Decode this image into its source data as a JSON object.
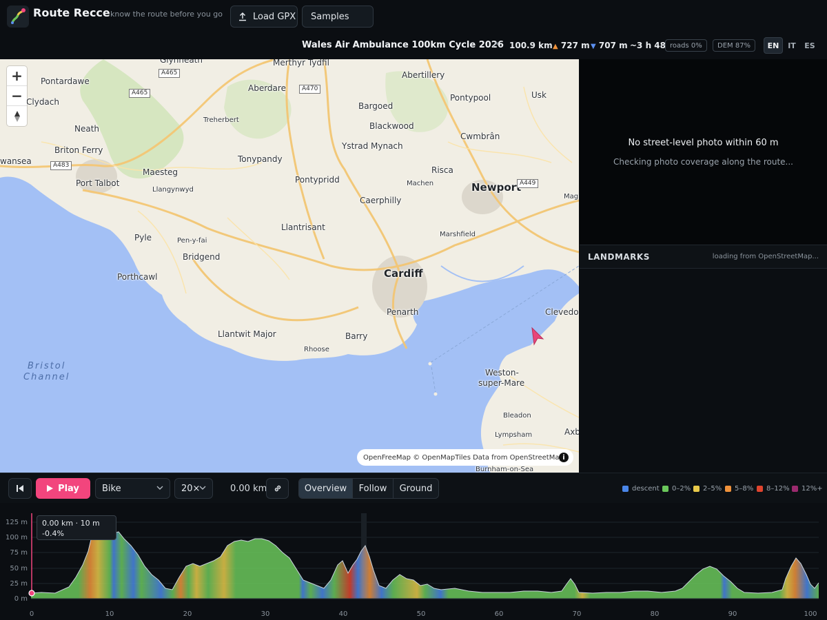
{
  "app": {
    "name": "Route Recce",
    "tagline": "know the route before you go"
  },
  "header": {
    "load_gpx_label": "Load GPX",
    "samples_label": "Samples"
  },
  "route": {
    "name": "Wales Air Ambulance 100km Cycle 2026",
    "distance": "100.9 km",
    "ascent": "727 m",
    "descent": "707 m",
    "duration": "~3 h 48",
    "roads_badge": "roads 0%",
    "dem_badge": "DEM 87%"
  },
  "languages": [
    {
      "code": "EN",
      "active": true
    },
    {
      "code": "IT",
      "active": false
    },
    {
      "code": "ES",
      "active": false
    }
  ],
  "map": {
    "towns": {
      "glynneath": "Glynneath",
      "merthyr": "Merthyr Tydfil",
      "abertillery": "Abertillery",
      "pontardawe": "Pontardawe",
      "aberdare": "Aberdare",
      "pontypool": "Pontypool",
      "usk": "Usk",
      "clydach": "Clydach",
      "bargoed": "Bargoed",
      "blackwood": "Blackwood",
      "cwmbran": "Cwmbrân",
      "neath": "Neath",
      "treherbert": "Treherbert",
      "britonferry": "Briton Ferry",
      "ystradmynach": "Ystrad Mynach",
      "swansea": "wansea",
      "tonypandy": "Tonypandy",
      "maesteg": "Maesteg",
      "risca": "Risca",
      "portalbot": "Port Talbot",
      "llangynwyd": "Llangynwyd",
      "pontypridd": "Pontypridd",
      "machen": "Machen",
      "newport": "Newport",
      "magor": "Mag",
      "caerphilly": "Caerphilly",
      "llantrisant": "Llantrisant",
      "marshfield": "Marshfield",
      "pyle": "Pyle",
      "penyfai": "Pen-y-fai",
      "bridgend": "Bridgend",
      "cardiff": "Cardiff",
      "porthcawl": "Porthcawl",
      "penarth": "Penarth",
      "clevedon": "Clevedo",
      "llantwit": "Llantwit Major",
      "barry": "Barry",
      "rhoose": "Rhoose",
      "weston1": "Weston-",
      "weston2": "super-Mare",
      "bleadon": "Bleadon",
      "lympsham": "Lympsham",
      "axbridge": "Axb",
      "burnham": "Burnham-on-Sea"
    },
    "water": {
      "line1": "Bristol",
      "line2": "Channel"
    },
    "shields": {
      "a465a": "A465",
      "a465b": "A465",
      "a470": "A470",
      "a483": "A483",
      "a449": "A449"
    },
    "attribution": "OpenFreeMap © OpenMapTiles Data from OpenStreetMap",
    "zoom_in": "+",
    "zoom_out": "−"
  },
  "photo_panel": {
    "title": "No street-level photo within 60 m",
    "subtitle": "Checking photo coverage along the route..."
  },
  "landmarks": {
    "title": "LANDMARKS",
    "status": "loading from OpenStreetMap..."
  },
  "controls": {
    "play_label": "Play",
    "mode_value": "Bike",
    "speed_value": "20×",
    "distance": "0.00 km",
    "views": [
      "Overview",
      "Follow",
      "Ground"
    ],
    "active_view": "Overview"
  },
  "legend": [
    {
      "label": "descent",
      "color": "#4a86e8"
    },
    {
      "label": "0–2%",
      "color": "#6ac75b"
    },
    {
      "label": "2–5%",
      "color": "#e8c94a"
    },
    {
      "label": "5–8%",
      "color": "#f0923b"
    },
    {
      "label": "8–12%",
      "color": "#e0442e"
    },
    {
      "label": "12%+",
      "color": "#9b2a6e"
    }
  ],
  "elevation": {
    "y_ticks": [
      "125 m",
      "100 m",
      "75 m",
      "50 m",
      "25 m",
      "0 m"
    ],
    "x_ticks": [
      "0",
      "10",
      "20",
      "30",
      "40",
      "50",
      "60",
      "70",
      "80",
      "90",
      "100"
    ],
    "tooltip_line1": "0.00 km · 10 m",
    "tooltip_line2": "-0.4%"
  }
}
